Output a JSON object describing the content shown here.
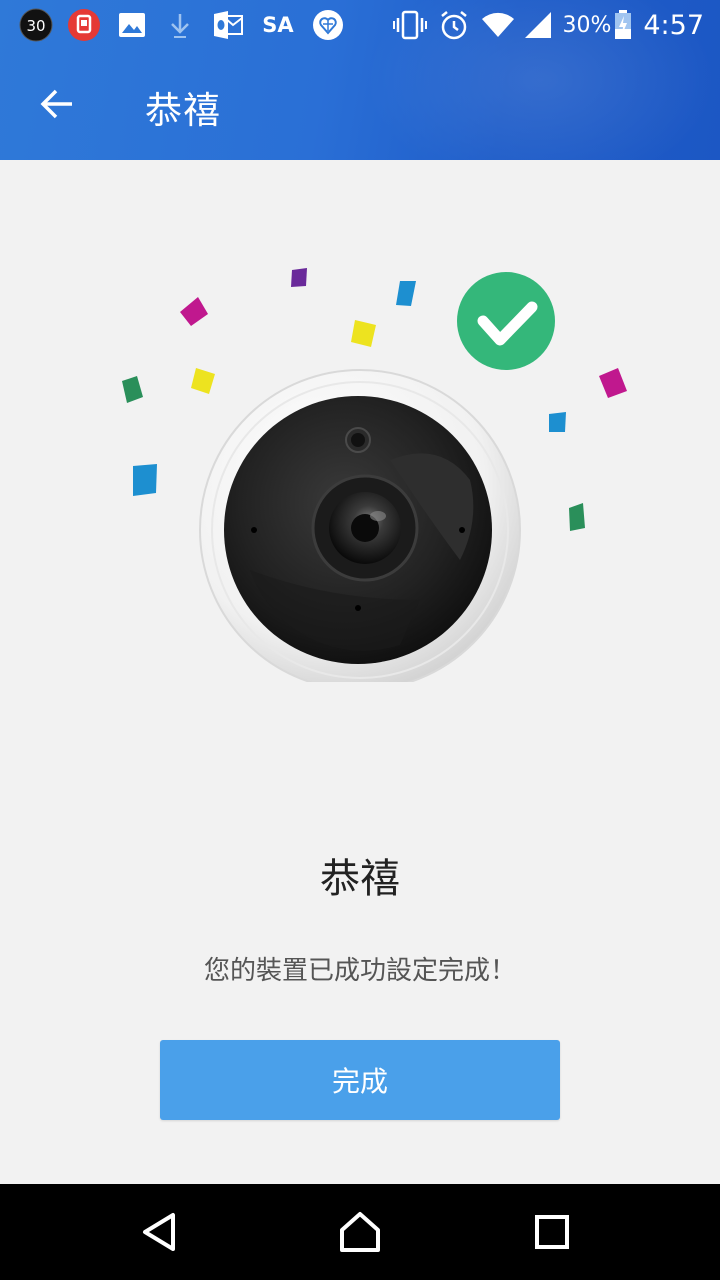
{
  "status_bar": {
    "notification_count": "30",
    "carrier_label": "SA",
    "battery_percent": "30%",
    "time": "4:57",
    "left_icons": [
      "badge-30-icon",
      "red-app-icon",
      "image-icon",
      "download-icon",
      "outlook-icon",
      "sa-label",
      "heart-badge-icon"
    ],
    "right_icons": [
      "vibrate-icon",
      "alarm-icon",
      "wifi-icon",
      "signal-icon",
      "battery-icon"
    ]
  },
  "app_bar": {
    "title": "恭禧",
    "back_icon": "arrow-back-icon"
  },
  "main": {
    "heading": "恭禧",
    "message": "您的裝置已成功設定完成！",
    "done_button": "完成"
  },
  "colors": {
    "app_bar": "#2a6fd6",
    "button": "#4aa0ea",
    "success_badge": "#34b77a",
    "background": "#f2f2f2"
  },
  "nav_bar": {
    "buttons": [
      "back-triangle-icon",
      "home-icon",
      "recents-icon"
    ]
  }
}
